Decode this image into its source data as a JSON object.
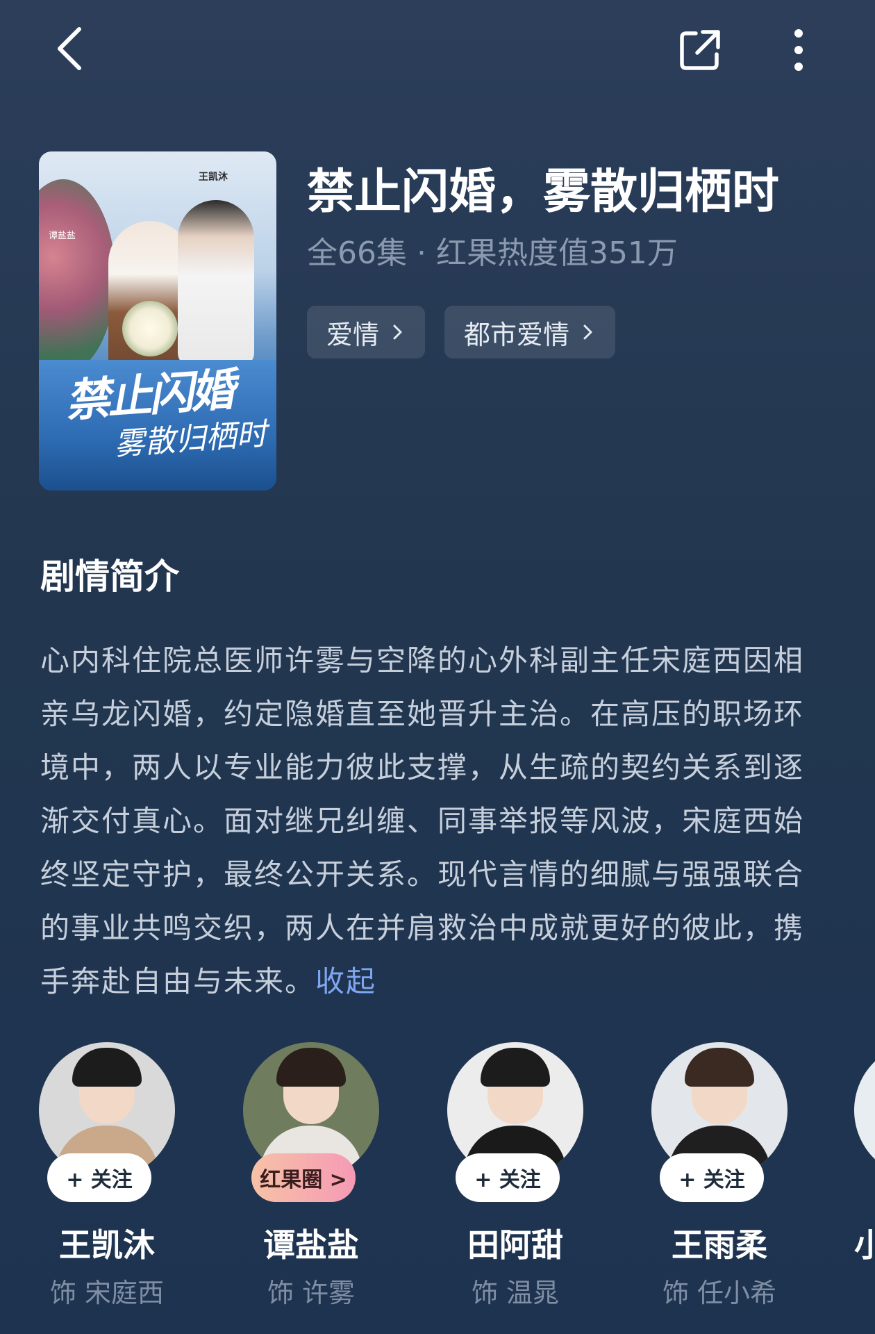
{
  "header": {
    "back_icon": "chevron-left-icon",
    "share_icon": "share-icon",
    "more_icon": "more-vertical-icon"
  },
  "poster": {
    "title_line1": "禁止闪婚",
    "title_line2": "雾散归栖时",
    "cast_top": "王凯沐",
    "cast_left": "谭盐盐"
  },
  "show": {
    "title": "禁止闪婚，雾散归栖时",
    "meta": "全66集 · 红果热度值351万",
    "tags": [
      {
        "label": "爱情"
      },
      {
        "label": "都市爱情"
      }
    ]
  },
  "synopsis": {
    "heading": "剧情简介",
    "text": "心内科住院总医师许雾与空降的心外科副主任宋庭西因相亲乌龙闪婚，约定隐婚直至她晋升主治。在高压的职场环境中，两人以专业能力彼此支撑，从生疏的契约关系到逐渐交付真心。面对继兄纠缠、同事举报等风波，宋庭西始终坚定守护，最终公开关系。现代言情的细腻与强强联合的事业共鸣交织，两人在并肩救治中成就更好的彼此，携手奔赴自由与未来。",
    "collapse_label": "收起"
  },
  "cast": [
    {
      "name": "王凯沐",
      "role": "饰 宋庭西",
      "action": "+ 关注"
    },
    {
      "name": "谭盐盐",
      "role": "饰 许雾",
      "action": "红果圈 >"
    },
    {
      "name": "田阿甜",
      "role": "饰 温晁",
      "action": "+ 关注"
    },
    {
      "name": "王雨柔",
      "role": "饰 任小希",
      "action": "+ 关注"
    }
  ],
  "cast_partial_name": "小",
  "colors": {
    "background": "#22364f",
    "accent_link": "#7fa6f0",
    "muted_text": "#8c9ab0"
  }
}
